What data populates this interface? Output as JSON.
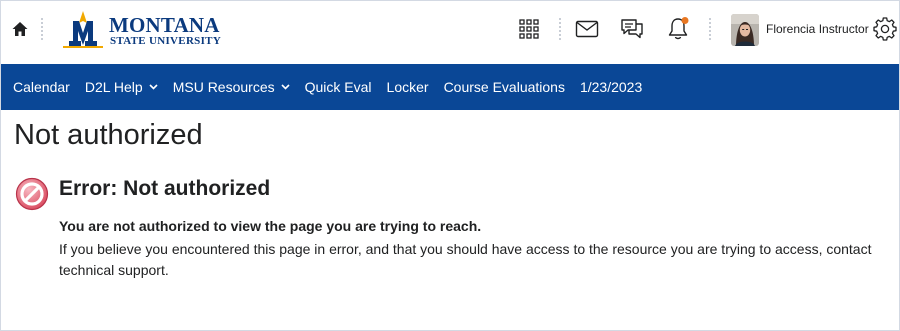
{
  "header": {
    "logo": {
      "name": "MONTANA",
      "subtitle": "STATE UNIVERSITY"
    },
    "user_name": "Florencia Instructor",
    "icons": [
      "home-icon",
      "waffle-grid-icon",
      "mail-icon",
      "chat-icon",
      "bell-icon",
      "gear-icon"
    ],
    "notification_dot_color": "#e87722"
  },
  "navbar": {
    "background": "#0a4796",
    "items": [
      {
        "label": "Calendar",
        "has_dropdown": false
      },
      {
        "label": "D2L Help",
        "has_dropdown": true
      },
      {
        "label": "MSU Resources",
        "has_dropdown": true
      },
      {
        "label": "Quick Eval",
        "has_dropdown": false
      },
      {
        "label": "Locker",
        "has_dropdown": false
      },
      {
        "label": "Course Evaluations",
        "has_dropdown": false
      },
      {
        "label": "1/23/2023",
        "has_dropdown": false
      }
    ]
  },
  "main": {
    "title": "Not authorized",
    "error": {
      "heading": "Error: Not authorized",
      "strong": "You are not authorized to view the page you are trying to reach.",
      "body": "If you believe you encountered this page in error, and that you should have access to the resource you are trying to access, contact technical support."
    }
  }
}
